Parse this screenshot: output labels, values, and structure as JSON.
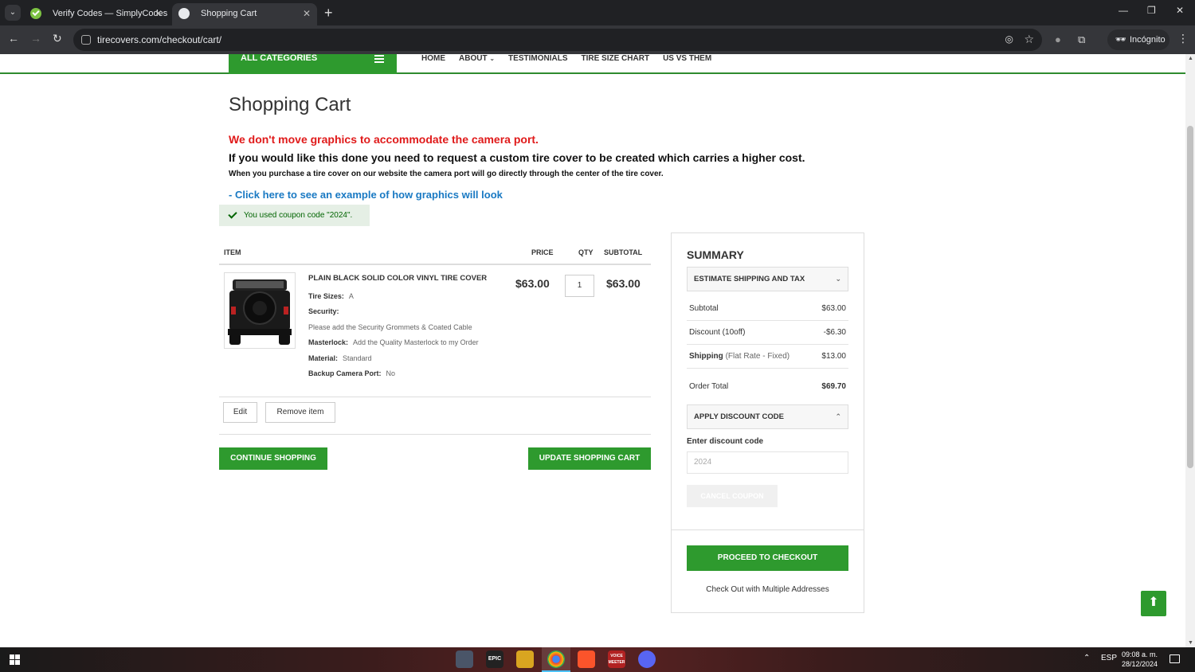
{
  "browser": {
    "tabs": [
      {
        "title": "Verify Codes — SimplyCodes",
        "active": false
      },
      {
        "title": "Shopping Cart",
        "active": true
      }
    ],
    "url": "tirecovers.com/checkout/cart/",
    "incognito_label": "Incógnito"
  },
  "nav": {
    "all_categories": "ALL CATEGORIES",
    "links": [
      "HOME",
      "ABOUT",
      "TESTIMONIALS",
      "TIRE SIZE CHART",
      "US VS THEM"
    ]
  },
  "page": {
    "title": "Shopping Cart",
    "notice_red": "We don't move graphics to accommodate the camera port.",
    "notice_black": "If you would like this done you need to request a custom tire cover to be created which carries a higher cost.",
    "notice_small": "When you purchase a tire cover on our website the camera port will go directly through the center of the tire cover.",
    "example_link": "- Click here to see an example of how graphics will look",
    "coupon_message": "You used coupon code \"2024\"."
  },
  "cart": {
    "columns": {
      "item": "ITEM",
      "price": "PRICE",
      "qty": "QTY",
      "subtotal": "SUBTOTAL"
    },
    "item": {
      "name": "PLAIN BLACK SOLID COLOR VINYL TIRE COVER",
      "options": [
        {
          "label": "Tire Sizes:",
          "value": "A"
        },
        {
          "label": "Security:",
          "value": ""
        },
        {
          "label": "",
          "value": "Please add the Security Grommets & Coated Cable"
        },
        {
          "label": "Masterlock:",
          "value": "Add the Quality Masterlock to my Order"
        },
        {
          "label": "Material:",
          "value": "Standard"
        },
        {
          "label": "Backup Camera Port:",
          "value": "No"
        }
      ],
      "price": "$63.00",
      "qty": "1",
      "subtotal": "$63.00"
    },
    "edit_label": "Edit",
    "remove_label": "Remove item",
    "continue_label": "CONTINUE SHOPPING",
    "update_label": "UPDATE SHOPPING CART"
  },
  "summary": {
    "title": "SUMMARY",
    "estimate_label": "ESTIMATE SHIPPING AND TAX",
    "rows": [
      {
        "label": "Subtotal",
        "value": "$63.00"
      },
      {
        "label": "Discount (10off)",
        "value": "-$6.30"
      },
      {
        "label": "Shipping",
        "label_extra": "(Flat Rate - Fixed)",
        "value": "$13.00"
      }
    ],
    "order_total_label": "Order Total",
    "order_total_value": "$69.70",
    "discount_accordion": "APPLY DISCOUNT CODE",
    "discount_field_label": "Enter discount code",
    "discount_field_value": "2024",
    "cancel_coupon": "CANCEL COUPON",
    "checkout_label": "PROCEED TO CHECKOUT",
    "multi_address": "Check Out with Multiple Addresses"
  },
  "taskbar": {
    "language": "ESP",
    "time": "09:08 a. m.",
    "date": "28/12/2024",
    "apps": [
      "EPIC",
      "VOICE MEETER"
    ]
  },
  "colors": {
    "brand_green": "#2e9a2e",
    "notice_red": "#e01a1a",
    "link_blue": "#1979c3"
  }
}
